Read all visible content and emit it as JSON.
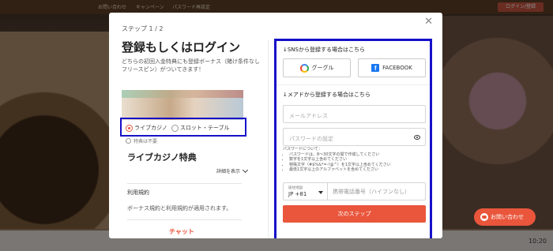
{
  "background": {
    "top_links": [
      "お問い合わせ",
      "キャンペーン",
      "パスワード再設定"
    ],
    "login_button": "ログイン/登録"
  },
  "modal": {
    "step": "ステップ 1 / 2",
    "title": "登録もしくはログイン",
    "description": "どちらの初回入金特典にも登録ボーナス（賭け条件なしフリースピン）がついてきます！",
    "bonus_options": [
      {
        "label": "ライブカジノ",
        "selected": true
      },
      {
        "label": "スロット・テーブル",
        "selected": false
      }
    ],
    "no_bonus": "特典は不要",
    "section_title": "ライブカジノ特典",
    "details_link": "詳細を表示",
    "terms_title": "利用規約",
    "terms_text": "ボーナス規約と利用規約が適用されます。",
    "chat_link": "チャット",
    "sns_label": "↓SNSから登録する場合はこちら",
    "google_label": "グーグル",
    "facebook_label": "FACEBOOK",
    "mail_label": "↓メアドから登録する場合はこちら",
    "email_placeholder": "メールアドレス",
    "password_placeholder": "パスワードの設定",
    "password_rules_title": "パスワードについて：",
    "password_rules": [
      "パスワードは、8〜30文字の間で作成してください",
      "数字を1文字以上含めてください",
      "特殊文字（#$%&*=-!@^）を1文字以上含めてください",
      "最低1文字以上のアルファベットを含めてください"
    ],
    "country_label": "居住地国",
    "country_code": "JP +81",
    "phone_placeholder": "携帯電話番号（ハイフンなし）",
    "next_button": "次のステップ"
  },
  "contact_button": "お問い合わせ",
  "clock": "10:20",
  "colors": {
    "accent": "#e9563c",
    "highlight_box": "#1610c8"
  }
}
